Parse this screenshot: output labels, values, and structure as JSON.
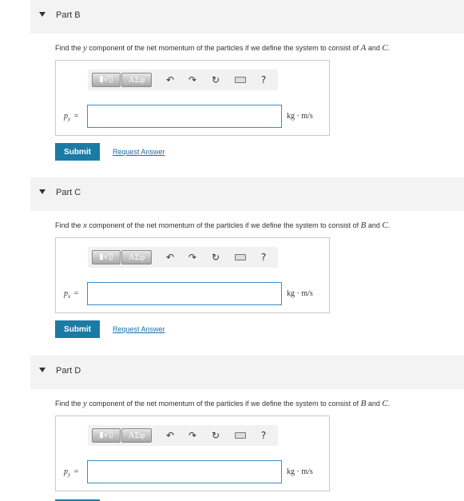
{
  "toolbar": {
    "templates_label": "▮√▯",
    "greek_label": "ΑΣφ",
    "undo_icon": "undo-icon",
    "redo_icon": "redo-icon",
    "reset_icon": "reset-icon",
    "keyboard_icon": "keyboard-icon",
    "help_label": "?"
  },
  "parts": [
    {
      "title": "Part B",
      "question_pre": "Find the ",
      "question_var": "y",
      "question_mid": " component of the net momentum of the particles if we define the system to consist of ",
      "question_a": "A",
      "question_and": " and ",
      "question_b": "C",
      "question_end": ".",
      "var_symbol": "p",
      "var_sub": "y",
      "equals": "=",
      "input_value": "",
      "units": "kg · m/s",
      "submit_label": "Submit",
      "request_label": "Request Answer"
    },
    {
      "title": "Part C",
      "question_pre": "Find the ",
      "question_var": "x",
      "question_mid": " component of the net momentum of the particles if we define the system to consist of ",
      "question_a": "B",
      "question_and": " and ",
      "question_b": "C",
      "question_end": ".",
      "var_symbol": "p",
      "var_sub": "x",
      "equals": "=",
      "input_value": "",
      "units": "kg · m/s",
      "submit_label": "Submit",
      "request_label": "Request Answer"
    },
    {
      "title": "Part D",
      "question_pre": "Find the ",
      "question_var": "y",
      "question_mid": " component of the net momentum of the particles if we define the system to consist of ",
      "question_a": "B",
      "question_and": " and ",
      "question_b": "C",
      "question_end": ".",
      "var_symbol": "p",
      "var_sub": "y",
      "equals": "=",
      "input_value": "",
      "units": "kg · m/s"
    }
  ]
}
